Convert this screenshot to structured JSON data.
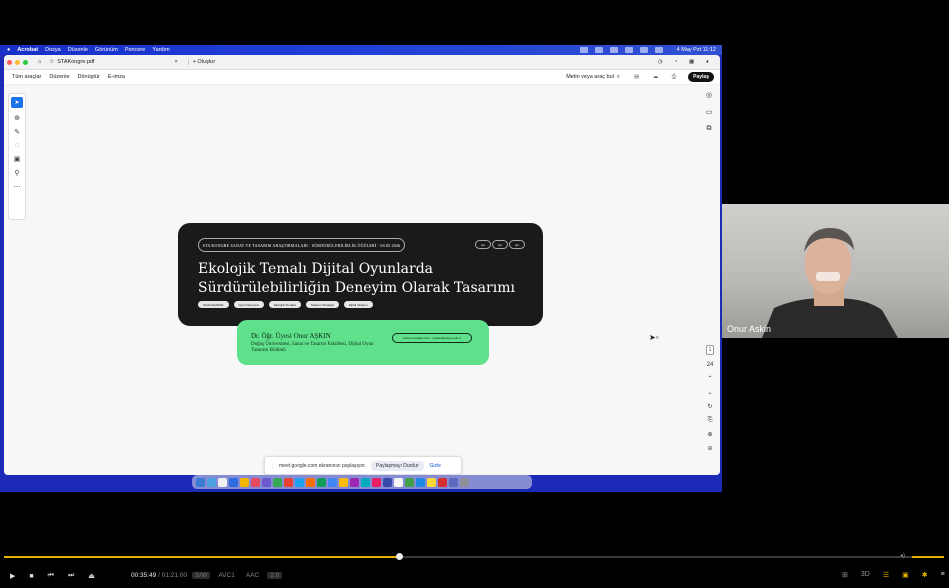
{
  "mac_menu": {
    "app": "Acrobat",
    "items": [
      "Dosya",
      "Düzenle",
      "Görünüm",
      "Pencere",
      "Yardım"
    ],
    "clock": "4 May Pzt 11:12"
  },
  "acrobat": {
    "tab_title": "STAKongre.pdf",
    "new_tab": "+ Oluştur",
    "toolbar_items": [
      "Tüm araçlar",
      "Düzenle",
      "Dönüştür",
      "E-imza"
    ],
    "search_label": "Metin veya araç bul",
    "share_label": "Paylaş",
    "page_current": "1",
    "page_total": "24"
  },
  "slide": {
    "header_pill": "STA KONGRE SANAT VE TASARIM ARAŞTIRMALARI · SÜRDÜRÜLEBİLİRLİK ÖĞÜLERİ · 04.05.2026",
    "small_pills": [
      "cpr",
      "cpr",
      "cpr"
    ],
    "title": "Ekolojik Temalı Dijital Oyunlarda Sürdürülebilirliğin Deneyim Olarak Tasarımı",
    "tags": [
      "Sürdürülebilirlik",
      "Oyun Deneyimi",
      "Ekolojik Temalar",
      "Tasarım Stratejisi",
      "Dijital Tasarım"
    ],
    "author": "Dr. Öğr. Üyesi Onur AŞKIN",
    "affiliation": "Doğuş Üniversitesi, Sanat ve Tasarım Fakültesi, Dijital Oyun Tasarımı Bölümü",
    "email": "www.onuraskin.com · oaskin@dogus.edu.tr"
  },
  "meet_bar": {
    "message": "meet.google.com ekranınızı paylaşıyor.",
    "stop_label": "Paylaşmayı Durdur",
    "hide_label": "Gizle"
  },
  "camera": {
    "participant": "Onur Askin"
  },
  "player": {
    "progress_fraction": 0.42,
    "current_time": "00:35:49",
    "total_time": "01:21:00",
    "badges": [
      "S/W",
      "AVC1",
      "AAC",
      "2.0"
    ],
    "accent": "#e6b400"
  }
}
